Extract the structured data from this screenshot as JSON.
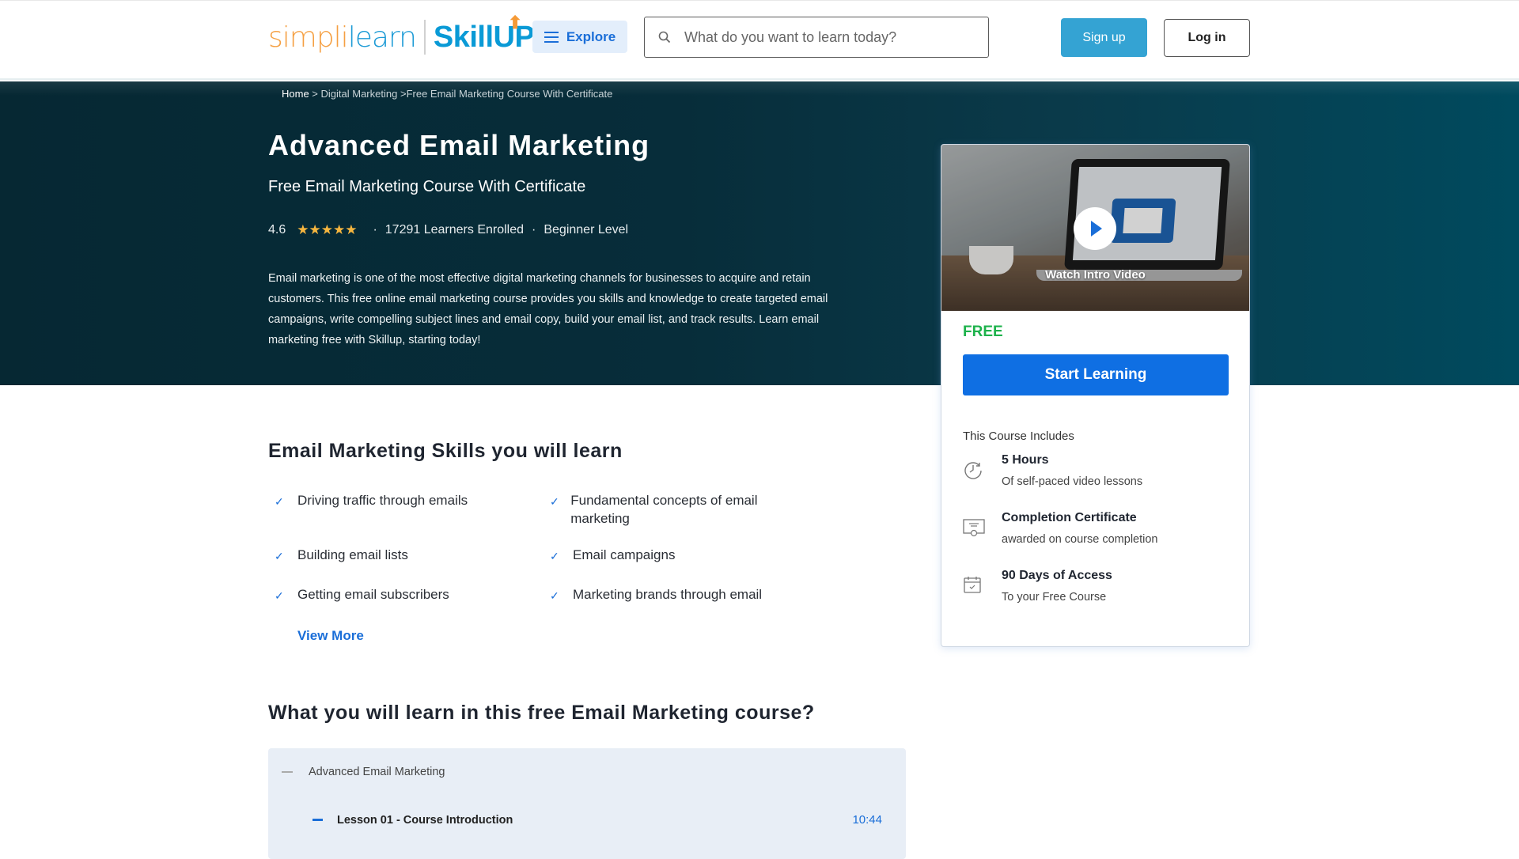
{
  "header": {
    "logo_simpli": "simpli",
    "logo_learn": "learn",
    "logo_skillup": "SkillUP",
    "explore_label": "Explore",
    "search_placeholder": "What do you want to learn today?",
    "signup_label": "Sign up",
    "login_label": "Log in"
  },
  "breadcrumb": {
    "home": "Home",
    "sep1": " > ",
    "category": "Digital Marketing",
    "sep2": " >",
    "current": "Free Email Marketing Course With Certificate"
  },
  "hero": {
    "title": "Advanced Email Marketing",
    "subtitle": "Free Email Marketing Course With Certificate",
    "rating": "4.6",
    "stars": "★★★★★",
    "learners": "17291 Learners Enrolled",
    "level": "Beginner Level",
    "description": "Email marketing is one of the most effective digital marketing channels for businesses to acquire and retain customers. This free online email marketing course provides you skills and knowledge to create targeted email campaigns, write compelling subject lines and email copy, build your email list, and track results. Learn email marketing free with Skillup, starting today!"
  },
  "card": {
    "watch_label": "Watch Intro Video",
    "price": "FREE",
    "start_label": "Start Learning",
    "includes_title": "This Course Includes",
    "includes": [
      {
        "icon": "clock-icon",
        "title": "5 Hours",
        "subtitle": "Of self-paced video lessons"
      },
      {
        "icon": "certificate-icon",
        "title": "Completion Certificate",
        "subtitle": "awarded on course completion"
      },
      {
        "icon": "calendar-icon",
        "title": "90 Days of Access",
        "subtitle": "To your Free Course"
      }
    ]
  },
  "skills": {
    "title": "Email Marketing Skills you will learn",
    "items": [
      "Driving traffic through emails",
      "Fundamental concepts of email marketing",
      "Building email lists",
      "Email campaigns",
      "Getting email subscribers",
      "Marketing brands through email"
    ],
    "view_more": "View More"
  },
  "curriculum": {
    "title": "What you will learn in this free Email Marketing course?",
    "section": "Advanced Email Marketing",
    "lessons": [
      {
        "title": "Lesson 01 - Course Introduction",
        "duration": "10:44"
      }
    ]
  },
  "colors": {
    "brand_blue": "#1a6ed8",
    "signup_blue": "#34a3d3",
    "free_green": "#1db24b",
    "star_gold": "#f6b63f",
    "hero_dark": "#062833",
    "hero_teal": "#004a5e"
  }
}
